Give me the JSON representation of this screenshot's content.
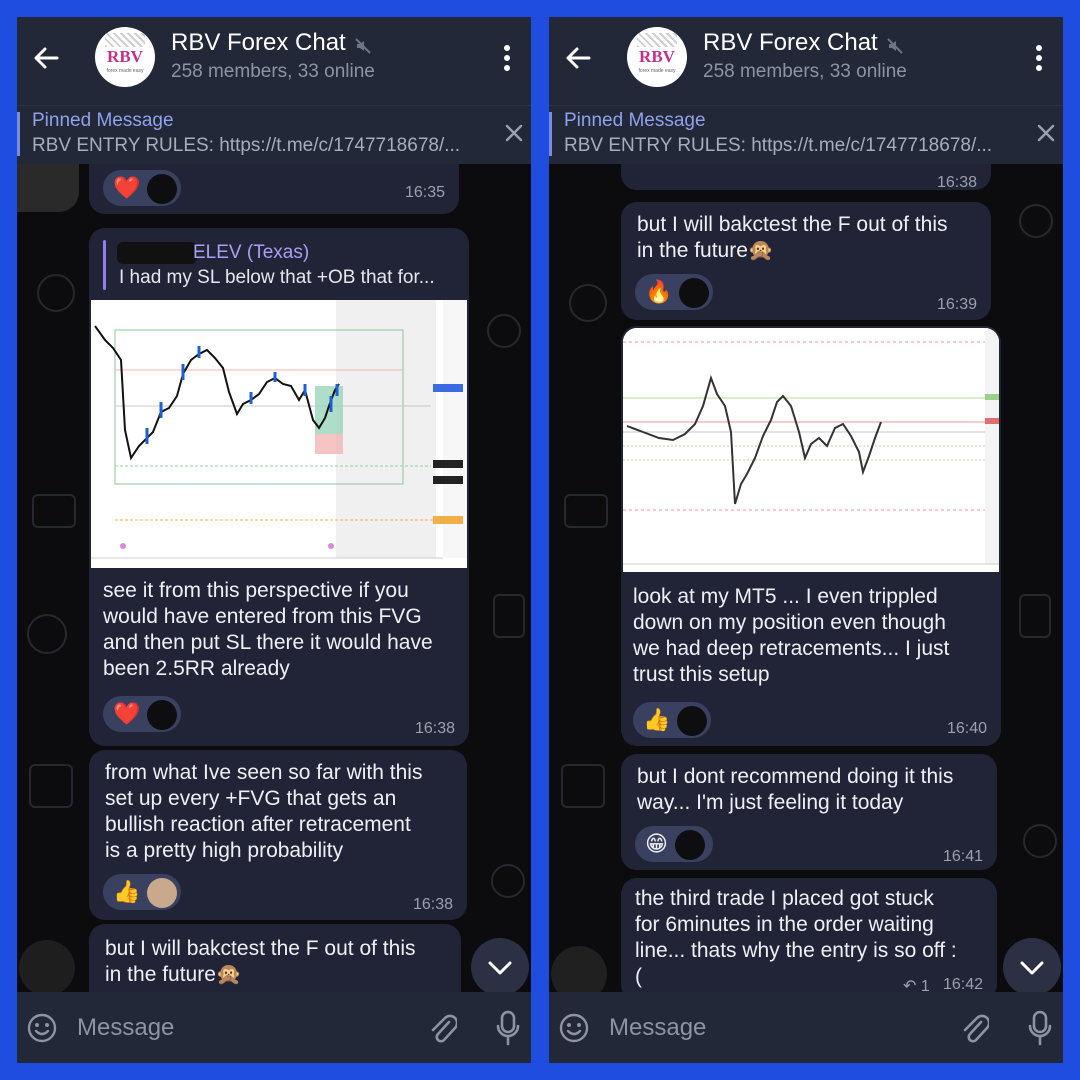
{
  "colors": {
    "frame": "#1f4de0",
    "header": "#232838",
    "bubble": "#212436",
    "accent": "#8fa2ea"
  },
  "chat": {
    "title": "RBV Forex Chat",
    "subtitle": "258 members, 33 online",
    "avatar_text": "RBV",
    "avatar_tagline": "forex made easy",
    "icons": [
      "back-arrow-icon",
      "mute-icon",
      "more-menu-icon",
      "close-icon",
      "emoji-icon",
      "attach-icon",
      "mic-icon",
      "chevron-down-icon"
    ]
  },
  "pinned": {
    "title": "Pinned Message",
    "text": "RBV ENTRY RULES: https://t.me/c/1747718678/..."
  },
  "composer": {
    "placeholder": "Message"
  },
  "left": {
    "top_time": "16:35",
    "msg1": {
      "reply_name": "ELEV (Texas)",
      "reply_text": "I had my SL below that +OB that for...",
      "lines": [
        "see it from this perspective if you",
        "would have entered from this FVG",
        "and then put SL there it would have",
        "been 2.5RR already"
      ],
      "reaction": "❤️",
      "time": "16:38"
    },
    "msg2": {
      "lines": [
        "from what Ive seen so far with this",
        "set up every +FVG that gets an",
        "bullish reaction after retracement",
        "is a pretty high probability"
      ],
      "reaction": "👍",
      "time": "16:38"
    },
    "msg3": {
      "lines": [
        "but I will bakctest the F out of this",
        "in the future🙊"
      ]
    }
  },
  "right": {
    "top_time": "16:38",
    "msg1": {
      "lines": [
        "but I will bakctest the F out of this",
        "in the future🙊"
      ],
      "reaction": "🔥",
      "time": "16:39"
    },
    "msg2": {
      "lines": [
        "look at my MT5 ... I even trippled",
        "down on my position even though",
        "we had deep retracements... I just",
        "trust this setup"
      ],
      "reaction": "👍",
      "time": "16:40"
    },
    "msg3": {
      "lines": [
        "but I dont recommend doing it this",
        "way... I'm just feeling it today"
      ],
      "reaction": "😁",
      "time": "16:41"
    },
    "msg4": {
      "lines": [
        "the third trade I placed got stuck",
        "for 6minutes in the order waiting",
        "line... thats why the entry is so off :",
        "("
      ],
      "replies": "↶ 1",
      "time": "16:42"
    }
  }
}
